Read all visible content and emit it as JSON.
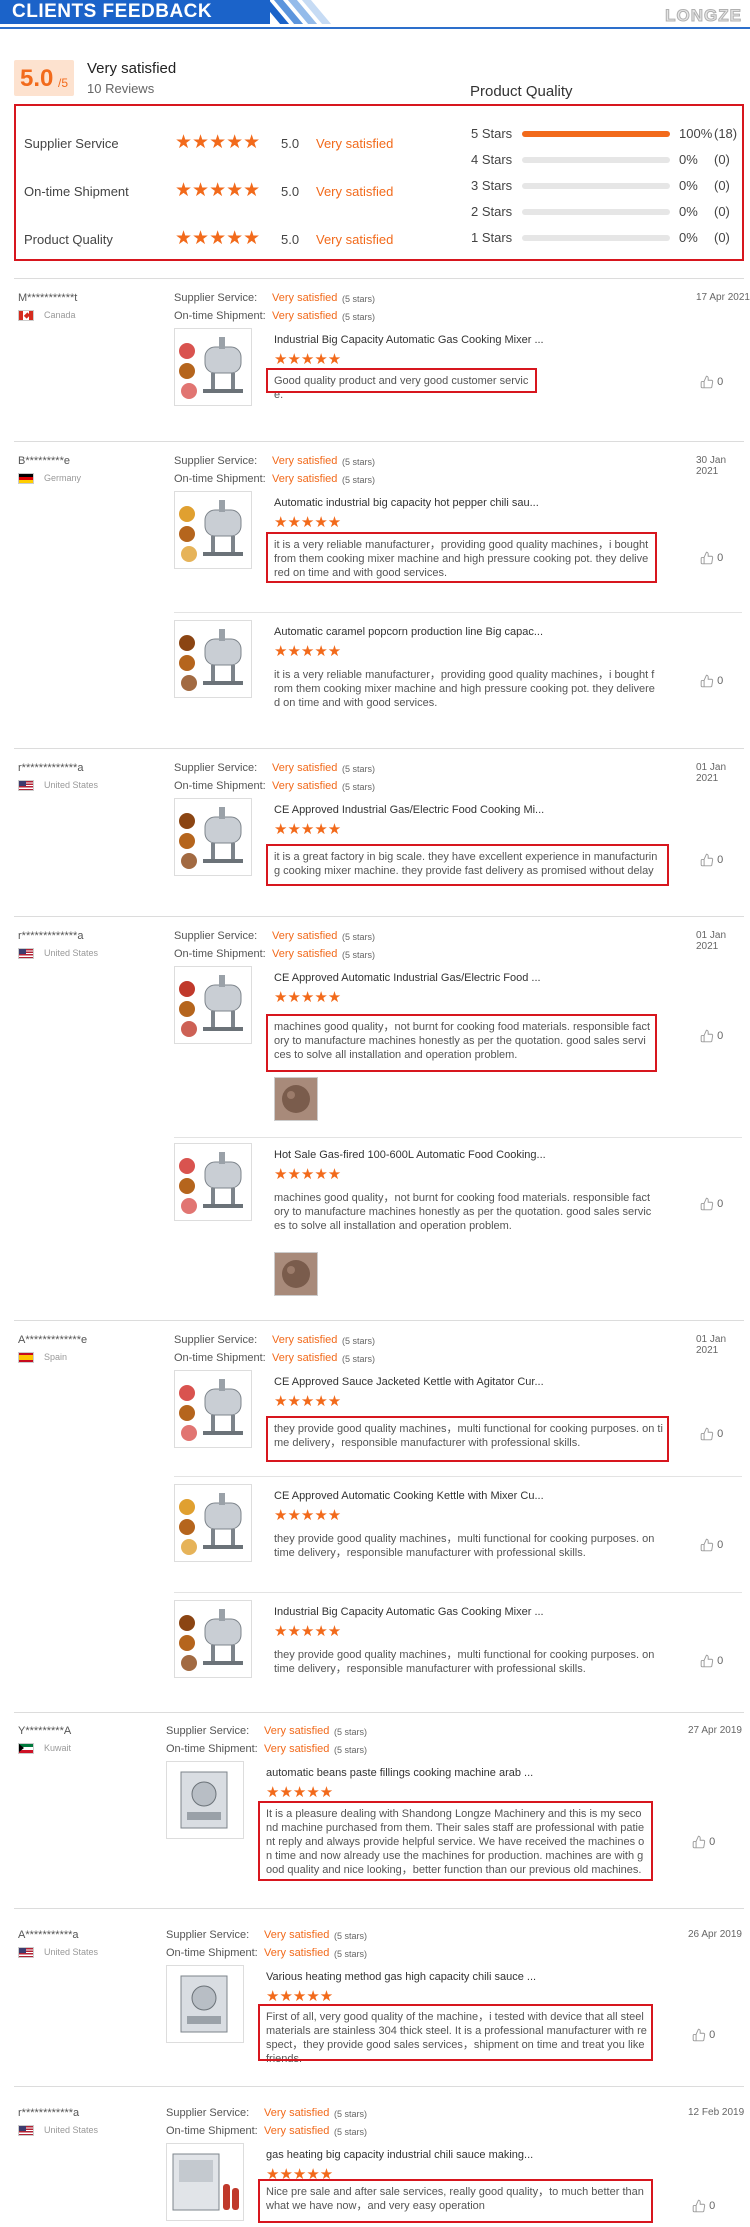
{
  "header": {
    "title": "CLIENTS FEEDBACK",
    "brand": "LONGZE",
    "accent": "#1b63c9"
  },
  "summary": {
    "score": "5.0",
    "score_suffix": "/5",
    "overall_text": "Very satisfied",
    "reviews_count": "10 Reviews",
    "pq_title": "Product Quality",
    "rows": [
      {
        "label": "Supplier Service",
        "stars": "★★★★★",
        "score": "5.0",
        "text": "Very satisfied"
      },
      {
        "label": "On-time Shipment",
        "stars": "★★★★★",
        "score": "5.0",
        "text": "Very satisfied"
      },
      {
        "label": "Product Quality",
        "stars": "★★★★★",
        "score": "5.0",
        "text": "Very satisfied"
      }
    ],
    "bars": [
      {
        "label": "5 Stars",
        "pct": "100%",
        "count": "(18)",
        "fill": 1.0
      },
      {
        "label": "4 Stars",
        "pct": "0%",
        "count": "(0)",
        "fill": 0
      },
      {
        "label": "3 Stars",
        "pct": "0%",
        "count": "(0)",
        "fill": 0
      },
      {
        "label": "2 Stars",
        "pct": "0%",
        "count": "(0)",
        "fill": 0
      },
      {
        "label": "1 Stars",
        "pct": "0%",
        "count": "(0)",
        "fill": 0
      }
    ]
  },
  "labels": {
    "supplier_service": "Supplier Service:",
    "ontime_shipment": "On-time Shipment:",
    "very_satisfied": "Very satisfied",
    "five_stars": "(5 stars)",
    "stars": "★★★★★"
  },
  "reviews": [
    {
      "name": "M***********t",
      "country": "Canada",
      "date": "17 Apr 2021",
      "items": [
        {
          "title": "Industrial Big Capacity Automatic Gas Cooking Mixer ...",
          "comment": "Good quality product and very good customer service.",
          "likes": "0"
        }
      ]
    },
    {
      "name": "B*********e",
      "country": "Germany",
      "date": "30 Jan 2021",
      "items": [
        {
          "title": "Automatic industrial big capacity hot pepper chili sau...",
          "comment": "it is a very reliable manufacturer，providing good quality machines，i bought from them cooking mixer machine and high pressure cooking pot. they delivered on time and with good services.",
          "likes": "0"
        },
        {
          "title": "Automatic caramel popcorn production line Big capac...",
          "comment": "it is a very reliable manufacturer，providing good quality machines，i bought from them cooking mixer machine and high pressure cooking pot. they delivered on time and with good services.",
          "likes": "0"
        }
      ]
    },
    {
      "name": "r*************a",
      "country": "United States",
      "date": "01 Jan 2021",
      "items": [
        {
          "title": "CE Approved Industrial Gas/Electric Food Cooking Mi...",
          "comment": "it is a great factory in big scale. they have excellent experience in manufacturing cooking mixer machine. they provide fast delivery as promised without delay",
          "likes": "0"
        }
      ]
    },
    {
      "name": "r*************a",
      "country": "United States",
      "date": "01 Jan 2021",
      "items": [
        {
          "title": "CE Approved Automatic Industrial Gas/Electric Food ...",
          "comment": "machines good quality，not burnt for cooking food materials. responsible factory to manufacture machines honestly as per the quotation. good sales services to solve all installation and operation problem.",
          "likes": "0"
        },
        {
          "title": "Hot Sale Gas-fired 100-600L Automatic Food Cooking...",
          "comment": "machines good quality，not burnt for cooking food materials. responsible factory to manufacture machines honestly as per the quotation. good sales services to solve all installation and operation problem.",
          "likes": "0"
        }
      ]
    },
    {
      "name": "A*************e",
      "country": "Spain",
      "date": "01 Jan 2021",
      "items": [
        {
          "title": "CE Approved Sauce Jacketed Kettle with Agitator Cur...",
          "comment": "they provide good quality machines，multi functional for cooking purposes. on time delivery，responsible manufacturer with professional skills.",
          "likes": "0"
        },
        {
          "title": "CE Approved Automatic Cooking Kettle with Mixer Cu...",
          "comment": "they provide good quality machines，multi functional for cooking purposes. on time delivery，responsible manufacturer with professional skills.",
          "likes": "0"
        },
        {
          "title": "Industrial Big Capacity Automatic Gas Cooking Mixer ...",
          "comment": "they provide good quality machines，multi functional for cooking purposes. on time delivery，responsible manufacturer with professional skills.",
          "likes": "0"
        }
      ]
    },
    {
      "name": "Y*********A",
      "country": "Kuwait",
      "date": "27 Apr 2019",
      "items": [
        {
          "title": "automatic beans paste fillings cooking machine arab ...",
          "comment": "It is a pleasure dealing with Shandong Longze Machinery and  this is  my second machine purchased from them. Their sales staff are professional with patient reply and always provide helpful service. We have received the machines on time and now already use the machines for production. machines are with good quality and nice looking，better function than our previous old machines.",
          "likes": "0"
        }
      ]
    },
    {
      "name": "A***********a",
      "country": "United States",
      "date": "26 Apr 2019",
      "items": [
        {
          "title": "Various heating method gas high capacity chili sauce ...",
          "comment": "First of all, very good quality of the machine，i tested with device that all steel materials are stainless 304 thick steel. It is a professional manufacturer with respect，they provide good sales services，shipment on time and treat you like friends.",
          "likes": "0"
        }
      ]
    },
    {
      "name": "r************a",
      "country": "United States",
      "date": "12 Feb 2019",
      "items": [
        {
          "title": "gas heating big capacity industrial chili sauce making...",
          "comment": "Nice pre sale and after sale services, really good quality，to much better than what we have now，and very easy operation",
          "likes": "0"
        }
      ]
    }
  ]
}
